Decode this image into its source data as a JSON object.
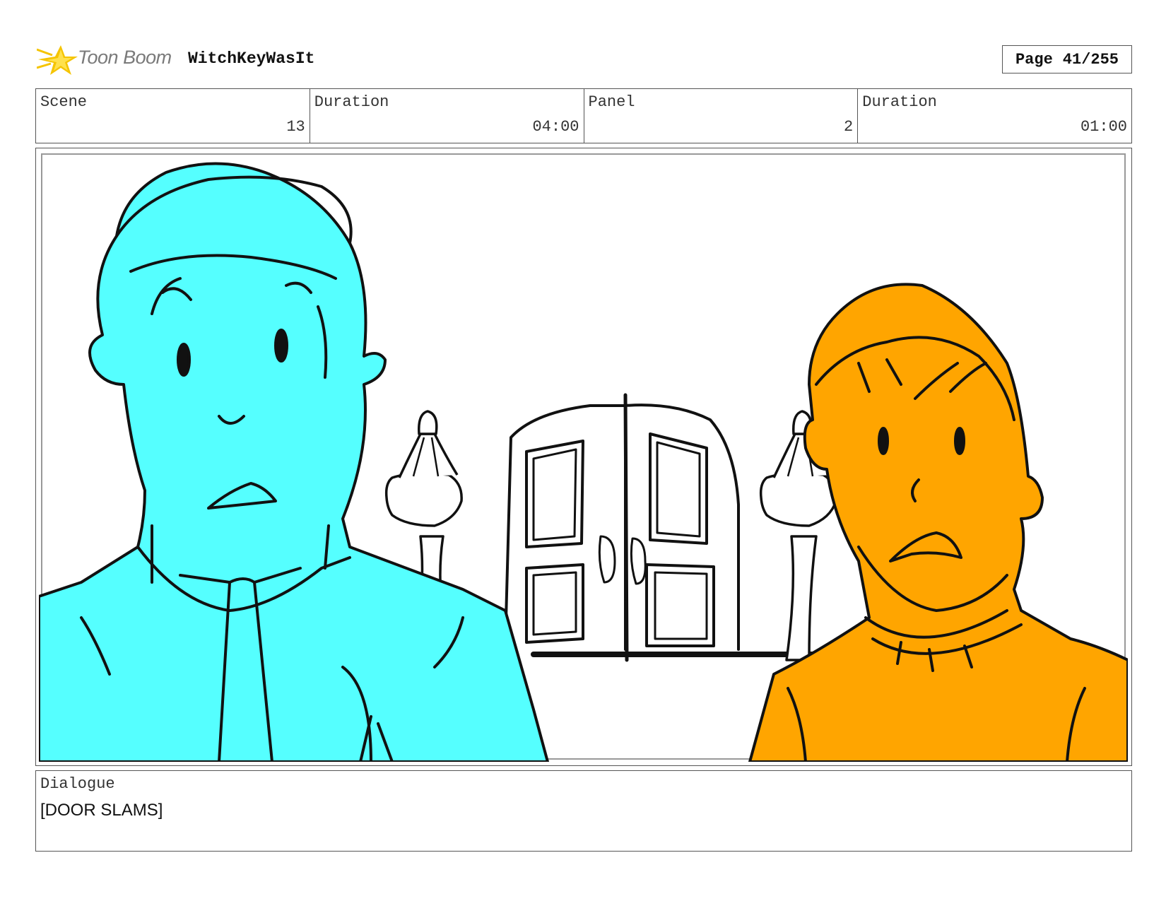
{
  "header": {
    "brand": "Toon Boom",
    "project_title": "WitchKeyWasIt",
    "page_label": "Page",
    "page_value": "41/255"
  },
  "info": {
    "scene_label": "Scene",
    "scene_value": "13",
    "scene_duration_label": "Duration",
    "scene_duration_value": "04:00",
    "panel_label": "Panel",
    "panel_value": "2",
    "panel_duration_label": "Duration",
    "panel_duration_value": "01:00"
  },
  "dialogue": {
    "label": "Dialogue",
    "text": "[DOOR SLAMS]"
  },
  "colors": {
    "character_left": "#55ffff",
    "character_right": "#ffa500",
    "logo_yellow": "#f5c400"
  },
  "icons": {
    "logo": "toon-boom-star-logo"
  }
}
